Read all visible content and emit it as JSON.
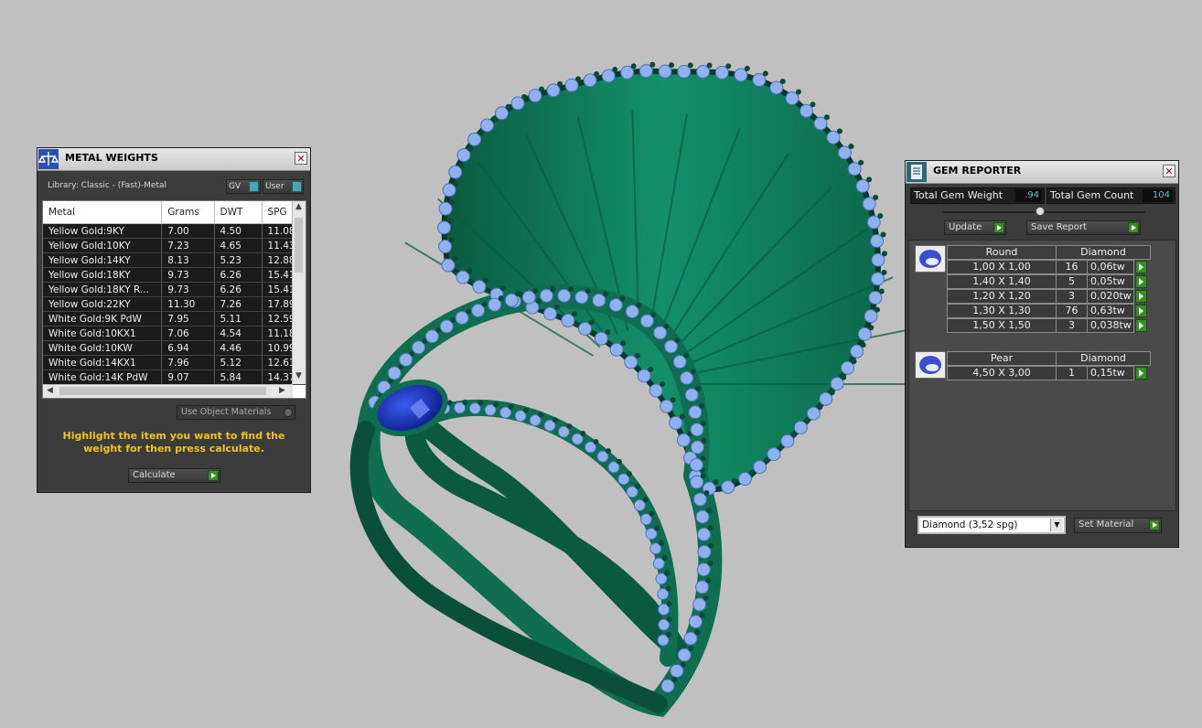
{
  "viewport": {
    "colors": {
      "background": "#c0c0c0",
      "metal": "#0e6e4f",
      "metal_dark": "#0a4a35",
      "gems": "#8fb2ee",
      "center_stone": "#1a2fb8"
    }
  },
  "metal_weights": {
    "title": "METAL WEIGHTS",
    "library": "Library: Classic - (Fast)-Metal",
    "toggle_gv": "GV",
    "toggle_user": "User",
    "columns": [
      "Metal",
      "Grams",
      "DWT",
      "SPG"
    ],
    "rows": [
      [
        "Yellow Gold:9KY",
        "7.00",
        "4.50",
        "11.08"
      ],
      [
        "Yellow Gold:10KY",
        "7.23",
        "4.65",
        "11.43"
      ],
      [
        "Yellow Gold:14KY",
        "8.13",
        "5.23",
        "12.88"
      ],
      [
        "Yellow Gold:18KY",
        "9.73",
        "6.26",
        "15.41"
      ],
      [
        "Yellow Gold:18KY R...",
        "9.73",
        "6.26",
        "15.41"
      ],
      [
        "Yellow Gold:22KY",
        "11.30",
        "7.26",
        "17.89"
      ],
      [
        "White Gold:9K PdW",
        "7.95",
        "5.11",
        "12.59"
      ],
      [
        "White Gold:10KX1",
        "7.06",
        "4.54",
        "11.18"
      ],
      [
        "White Gold:10KW",
        "6.94",
        "4.46",
        "10.99"
      ],
      [
        "White Gold:14KX1",
        "7.96",
        "5.12",
        "12.61"
      ],
      [
        "White Gold:14K PdW",
        "9.07",
        "5.84",
        "14.37"
      ]
    ],
    "use_object_materials": "Use Object Materials",
    "hint": "Highlight the item you want to find the weight for then press calculate.",
    "calculate": "Calculate"
  },
  "gem_reporter": {
    "title": "GEM REPORTER",
    "total_weight_label": "Total Gem Weight",
    "total_weight_value": ".94",
    "total_count_label": "Total Gem Count",
    "total_count_value": "104",
    "update": "Update",
    "save_report": "Save Report",
    "groups": [
      {
        "shape": "Round",
        "material": "Diamond",
        "rows": [
          [
            "1,00 X 1,00",
            "16",
            "0,06tw"
          ],
          [
            "1,40 X 1,40",
            "5",
            "0,05tw"
          ],
          [
            "1,20 X 1,20",
            "3",
            "0,020tw"
          ],
          [
            "1,30 X 1,30",
            "76",
            "0,63tw"
          ],
          [
            "1,50 X 1,50",
            "3",
            "0,038tw"
          ]
        ]
      },
      {
        "shape": "Pear",
        "material": "Diamond",
        "rows": [
          [
            "4,50 X 3,00",
            "1",
            "0,15tw"
          ]
        ]
      }
    ],
    "material_select": "Diamond     (3,52 spg)",
    "set_material": "Set Material"
  }
}
